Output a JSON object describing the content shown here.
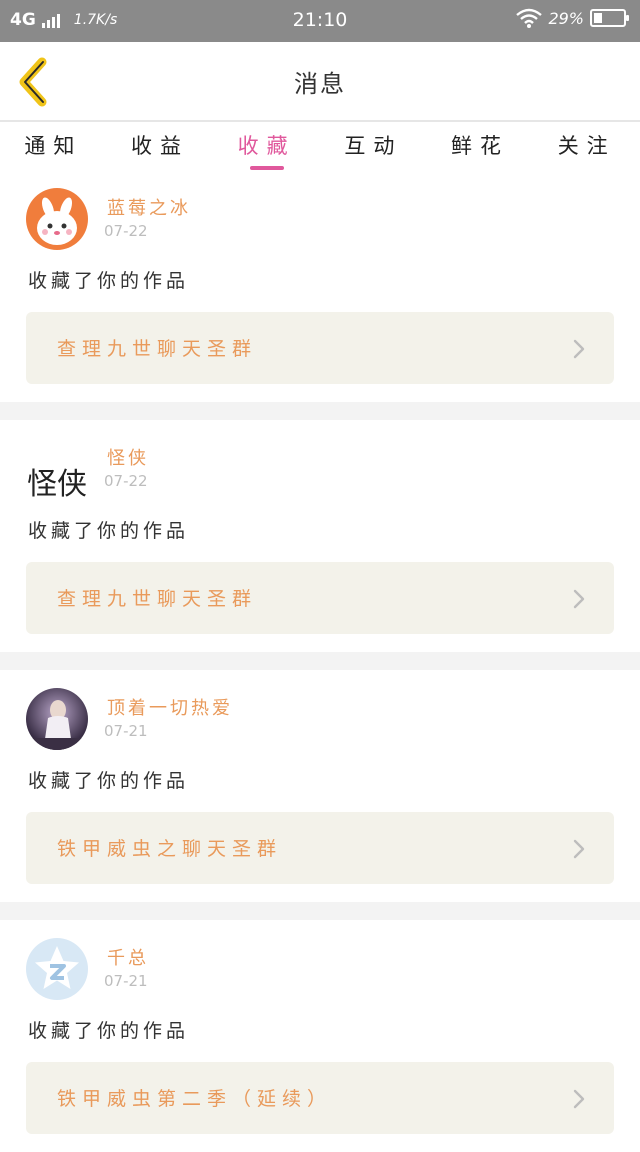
{
  "status_bar": {
    "network": "4G",
    "speed": "1.7K/s",
    "time": "21:10",
    "battery_text": "29%",
    "battery_level": 0.29
  },
  "header": {
    "title": "消息",
    "back_icon": "chevron-left-icon",
    "accent_color": "#e0589c",
    "back_color": "#f0c419"
  },
  "tabs": [
    {
      "label": "通知",
      "active": false
    },
    {
      "label": "收益",
      "active": false
    },
    {
      "label": "收藏",
      "active": true
    },
    {
      "label": "互动",
      "active": false
    },
    {
      "label": "鲜花",
      "active": false
    },
    {
      "label": "关注",
      "active": false
    }
  ],
  "notifications": [
    {
      "username": "蓝莓之冰",
      "date": "07-22",
      "action": "收藏了你的作品",
      "work_title": "查理九世聊天圣群",
      "avatar": "bunny-avatar"
    },
    {
      "username": "怪侠",
      "date": "07-22",
      "action": "收藏了你的作品",
      "work_title": "查理九世聊天圣群",
      "avatar": "calligraphy-avatar",
      "avatar_text": "怪侠"
    },
    {
      "username": "顶着一切热爱",
      "date": "07-21",
      "action": "收藏了你的作品",
      "work_title": "铁甲威虫之聊天圣群",
      "avatar": "photo-avatar"
    },
    {
      "username": "千总",
      "date": "07-21",
      "action": "收藏了你的作品",
      "work_title": "铁甲威虫第二季（延续）",
      "avatar": "qq-star-avatar"
    }
  ]
}
